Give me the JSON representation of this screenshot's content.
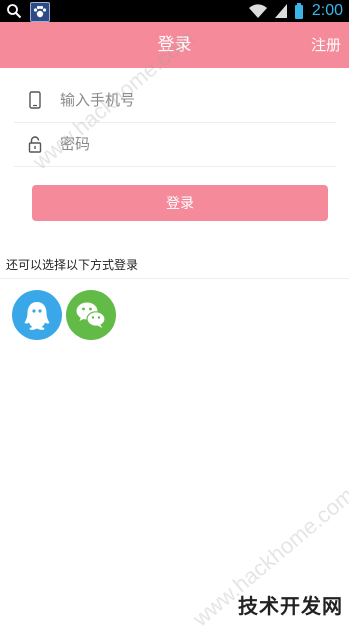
{
  "status_bar": {
    "time": "2:00"
  },
  "header": {
    "title": "登录",
    "register_label": "注册"
  },
  "form": {
    "phone_placeholder": "输入手机号",
    "password_placeholder": "密码",
    "login_button": "登录"
  },
  "alt_login": {
    "label": "还可以选择以下方式登录",
    "options": [
      {
        "icon": "qq-icon",
        "color": "#3aa8e8"
      },
      {
        "icon": "wechat-icon",
        "color": "#62bb46"
      }
    ]
  },
  "watermarks": {
    "diagonal": "www.hackhome.com",
    "corner": "技术开发网"
  },
  "colors": {
    "accent": "#f48a9a"
  }
}
